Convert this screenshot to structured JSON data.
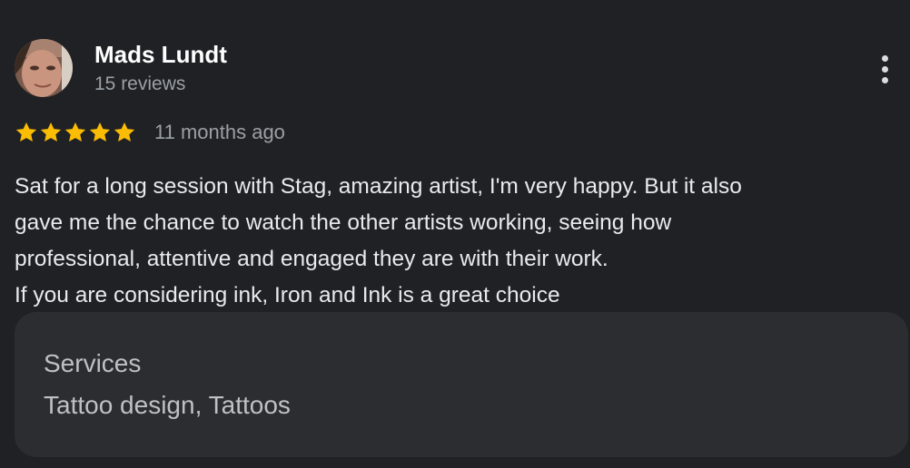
{
  "reviewer": {
    "name": "Mads Lundt",
    "review_count": "15 reviews",
    "avatar_icon": "user-photo-avatar"
  },
  "more_options_icon": "more-vert-icon",
  "rating": {
    "stars": 5,
    "max_stars": 5,
    "star_color": "#fbbc04",
    "time_ago": "11 months ago"
  },
  "review": {
    "lines": [
      "Sat for a long session with Stag, amazing artist, I'm very happy. But it also",
      "gave me the chance to watch the other artists working, seeing how",
      "professional, attentive and engaged they are with their work.",
      "If you are considering ink, Iron and Ink is a great choice"
    ]
  },
  "services": {
    "title": "Services",
    "value": "Tattoo design, Tattoos"
  },
  "colors": {
    "background": "#202124",
    "services_background": "#2c2d30",
    "primary_text": "#e8eaed",
    "secondary_text": "#9aa0a6"
  }
}
